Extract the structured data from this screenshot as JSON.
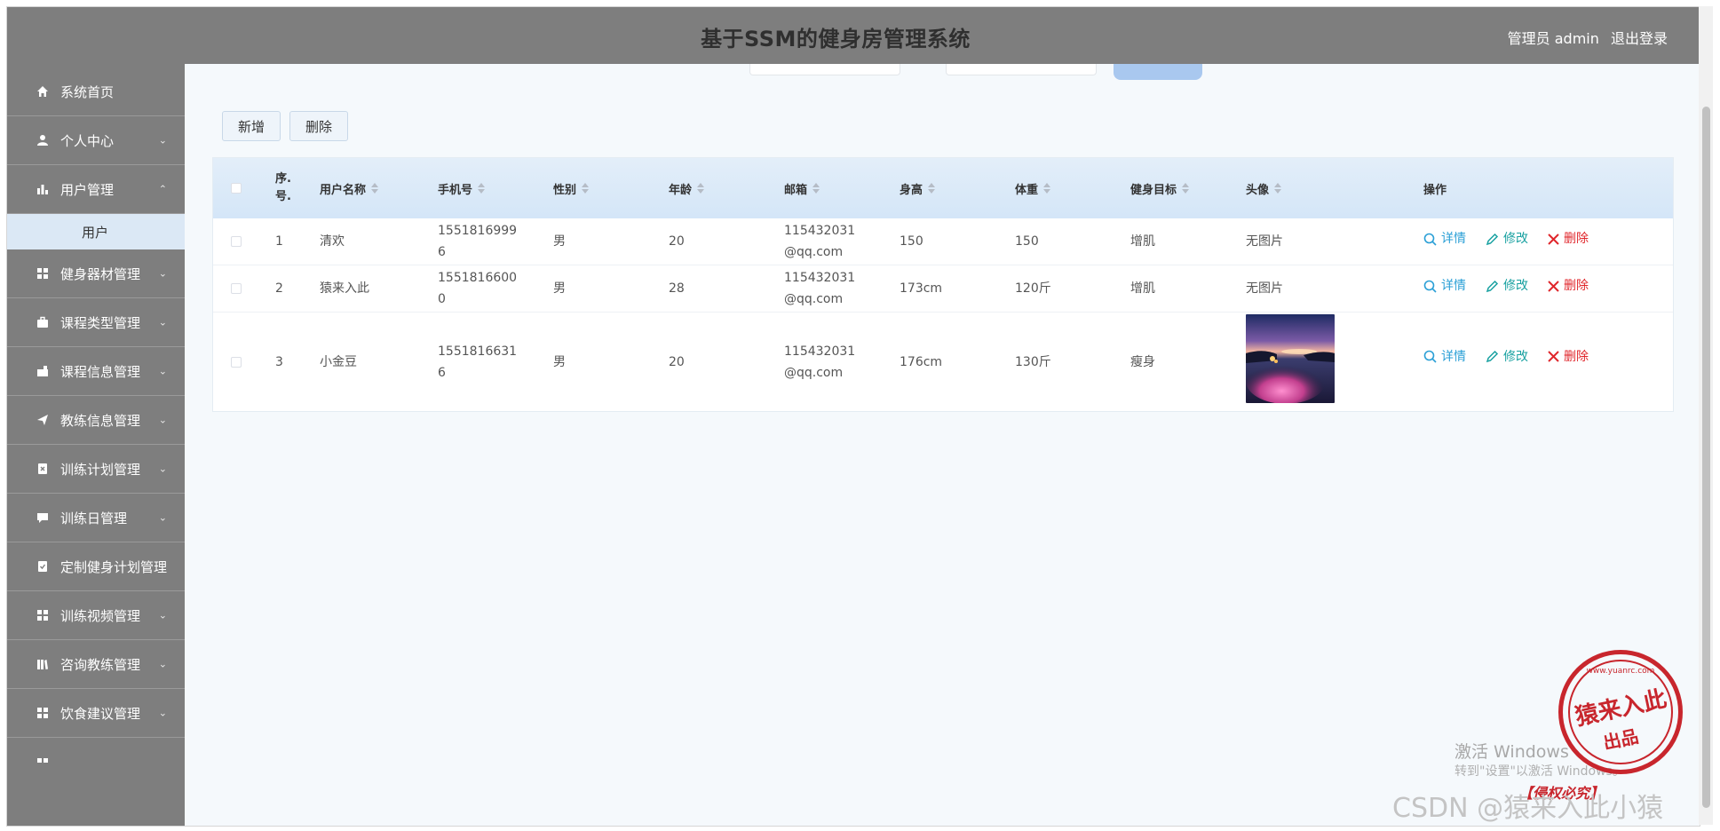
{
  "header": {
    "title": "基于SSM的健身房管理系统",
    "user_label": "管理员 admin",
    "logout_label": "退出登录"
  },
  "sidebar": {
    "items": [
      {
        "label": "系统首页",
        "icon": "home-icon",
        "chevron": ""
      },
      {
        "label": "个人中心",
        "icon": "user-icon",
        "chevron": "⌄"
      },
      {
        "label": "用户管理",
        "icon": "chart-icon",
        "chevron": "⌃"
      },
      {
        "label": "健身器材管理",
        "icon": "grid-icon",
        "chevron": "⌄"
      },
      {
        "label": "课程类型管理",
        "icon": "briefcase-icon",
        "chevron": "⌄"
      },
      {
        "label": "课程信息管理",
        "icon": "ticket-icon",
        "chevron": "⌄"
      },
      {
        "label": "教练信息管理",
        "icon": "send-icon",
        "chevron": "⌄"
      },
      {
        "label": "训练计划管理",
        "icon": "clipboard-x-icon",
        "chevron": "⌄"
      },
      {
        "label": "训练日管理",
        "icon": "comment-icon",
        "chevron": "⌄"
      },
      {
        "label": "定制健身计划管理",
        "icon": "clipboard-check-icon",
        "chevron": ""
      },
      {
        "label": "训练视频管理",
        "icon": "grid-icon",
        "chevron": "⌄"
      },
      {
        "label": "咨询教练管理",
        "icon": "library-icon",
        "chevron": "⌄"
      },
      {
        "label": "饮食建议管理",
        "icon": "grid-icon",
        "chevron": "⌄"
      }
    ],
    "submenu_label": "用户"
  },
  "toolbar": {
    "add_label": "新增",
    "delete_label": "删除"
  },
  "table": {
    "headers": {
      "index": "序.号.",
      "name": "用户名称",
      "phone": "手机号",
      "gender": "性别",
      "age": "年龄",
      "email": "邮箱",
      "height": "身高",
      "weight": "体重",
      "goal": "健身目标",
      "avatar": "头像",
      "actions": "操作"
    },
    "rows": [
      {
        "index": "1",
        "name": "清欢",
        "phone": "15518169996",
        "gender": "男",
        "age": "20",
        "email": "115432031@qq.com",
        "height": "150",
        "weight": "150",
        "goal": "增肌",
        "avatar": "无图片"
      },
      {
        "index": "2",
        "name": "猿来入此",
        "phone": "15518166000",
        "gender": "男",
        "age": "28",
        "email": "115432031@qq.com",
        "height": "173cm",
        "weight": "120斤",
        "goal": "增肌",
        "avatar": "无图片"
      },
      {
        "index": "3",
        "name": "小金豆",
        "phone": "15518166316",
        "gender": "男",
        "age": "20",
        "email": "115432031@qq.com",
        "height": "176cm",
        "weight": "130斤",
        "goal": "瘦身",
        "avatar": ""
      }
    ],
    "actions": {
      "detail": "详情",
      "edit": "修改",
      "delete": "删除"
    }
  },
  "watermarks": {
    "activate_line1": "激活 Windows",
    "activate_line2": "转到\"设置\"以激活 Windows。",
    "csdn": "CSDN @猿来入此小猿",
    "stamp_main": "猿来入此",
    "stamp_sub": "出品",
    "stamp_bottom": "【侵权必究】",
    "stamp_url": "www.yuanrc.com"
  },
  "colors": {
    "sidebar_bg": "#7e7e7e",
    "header_bg": "#7e7e7e",
    "detail": "#2a9fd6",
    "edit": "#19a1a1",
    "delete": "#e0262b",
    "stamp": "#c8262d"
  }
}
